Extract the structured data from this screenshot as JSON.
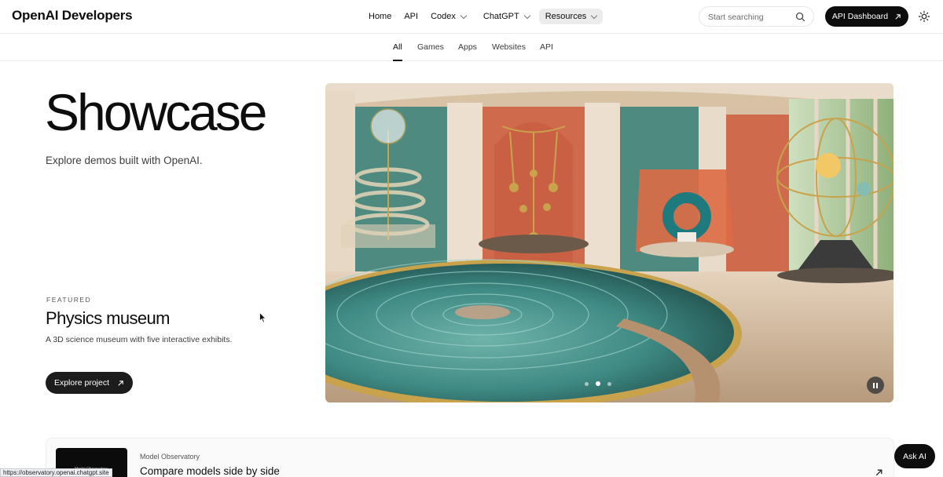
{
  "header": {
    "logo": "OpenAI Developers",
    "nav": [
      {
        "label": "Home"
      },
      {
        "label": "API"
      },
      {
        "label": "Codex"
      },
      {
        "label": "ChatGPT"
      },
      {
        "label": "Resources"
      }
    ],
    "search_placeholder": "Start searching",
    "dashboard_label": "API Dashboard"
  },
  "tabs": [
    {
      "label": "All"
    },
    {
      "label": "Games"
    },
    {
      "label": "Apps"
    },
    {
      "label": "Websites"
    },
    {
      "label": "API"
    }
  ],
  "hero": {
    "title": "Showcase",
    "subtitle": "Explore demos built with OpenAI."
  },
  "featured": {
    "label": "FEATURED",
    "title": "Physics museum",
    "description": "A 3D science museum with five interactive exhibits.",
    "button_label": "Explore project"
  },
  "carousel": {
    "slide_count": 3,
    "active_index": 1
  },
  "card": {
    "eyebrow": "Model Observatory",
    "title": "Compare models side by side",
    "thumb_text": "Model Observatory"
  },
  "ask_ai_label": "Ask AI",
  "status_url": "https://observatory.openai.chatgpt.site",
  "colors": {
    "primary": "#0d0d0d",
    "tab_active_bg": "#ececec",
    "wall_green": "#4f8a80",
    "wall_orange": "#d06a4c",
    "water": "#3f8a84",
    "gold": "#c9a24c"
  }
}
